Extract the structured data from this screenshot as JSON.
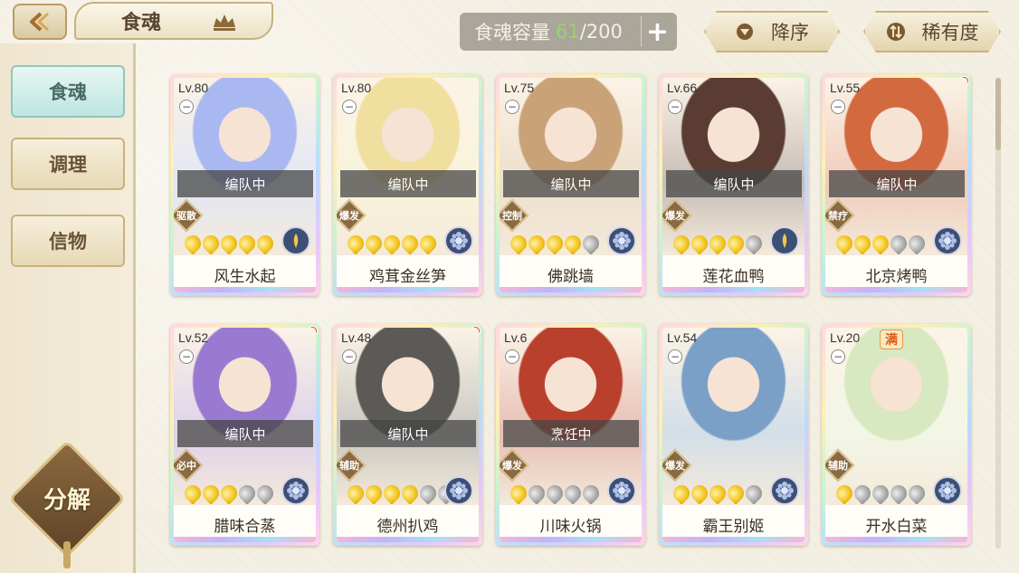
{
  "header": {
    "back_icon": "back-arrow-icon",
    "title": "食魂",
    "capacity_label": "食魂容量",
    "capacity_current": "61",
    "capacity_total": "/200",
    "add_label": "+",
    "sort_order_label": "降序",
    "sort_rarity_label": "稀有度"
  },
  "sidebar": {
    "items": [
      {
        "label": "食魂",
        "active": true
      },
      {
        "label": "调理",
        "active": false
      },
      {
        "label": "信物",
        "active": false
      }
    ],
    "decompose_label": "分解"
  },
  "colors": {
    "accent_gold": "#c8b27c",
    "active_tab": "#bde6e0",
    "capacity_highlight": "#9bd36a",
    "notification_red": "#e2433a"
  },
  "cards": [
    {
      "level": "Lv.80",
      "status": "编队中",
      "role": "驱散",
      "stars_on": 5,
      "stars_total": 5,
      "name": "风生水起",
      "elem": "gold",
      "dot": false,
      "full": false,
      "tint": "#a9b8f0"
    },
    {
      "level": "Lv.80",
      "status": "编队中",
      "role": "爆发",
      "stars_on": 5,
      "stars_total": 5,
      "name": "鸡茸金丝笋",
      "elem": "blue",
      "dot": false,
      "full": false,
      "tint": "#f1dfa0"
    },
    {
      "level": "Lv.75",
      "status": "编队中",
      "role": "控制",
      "stars_on": 4,
      "stars_total": 5,
      "name": "佛跳墙",
      "elem": "blue",
      "dot": false,
      "full": false,
      "tint": "#c9a277"
    },
    {
      "level": "Lv.66",
      "status": "编队中",
      "role": "爆发",
      "stars_on": 4,
      "stars_total": 5,
      "name": "莲花血鸭",
      "elem": "gold",
      "dot": false,
      "full": false,
      "tint": "#5a3c33"
    },
    {
      "level": "Lv.55",
      "status": "编队中",
      "role": "禁疗",
      "stars_on": 3,
      "stars_total": 5,
      "name": "北京烤鸭",
      "elem": "blue",
      "dot": true,
      "full": false,
      "tint": "#d2693f"
    },
    {
      "level": "Lv.52",
      "status": "编队中",
      "role": "必中",
      "stars_on": 3,
      "stars_total": 5,
      "name": "腊味合蒸",
      "elem": "blue",
      "dot": true,
      "full": false,
      "tint": "#9a7ad0"
    },
    {
      "level": "Lv.48",
      "status": "编队中",
      "role": "辅助",
      "stars_on": 4,
      "stars_total": 6,
      "name": "德州扒鸡",
      "elem": "blue",
      "dot": true,
      "full": false,
      "tint": "#5c5a56"
    },
    {
      "level": "Lv.6",
      "status": "烹饪中",
      "role": "爆发",
      "stars_on": 1,
      "stars_total": 5,
      "name": "川味火锅",
      "elem": "blue",
      "dot": false,
      "full": false,
      "tint": "#b8402c"
    },
    {
      "level": "Lv.54",
      "status": "",
      "role": "爆发",
      "stars_on": 4,
      "stars_total": 5,
      "name": "霸王别姬",
      "elem": "blue",
      "dot": false,
      "full": false,
      "tint": "#7aa0c8"
    },
    {
      "level": "Lv.20",
      "status": "",
      "role": "辅助",
      "stars_on": 1,
      "stars_total": 5,
      "name": "开水白菜",
      "elem": "blue",
      "dot": false,
      "full": true,
      "full_label": "满",
      "tint": "#d8e8c0"
    }
  ]
}
